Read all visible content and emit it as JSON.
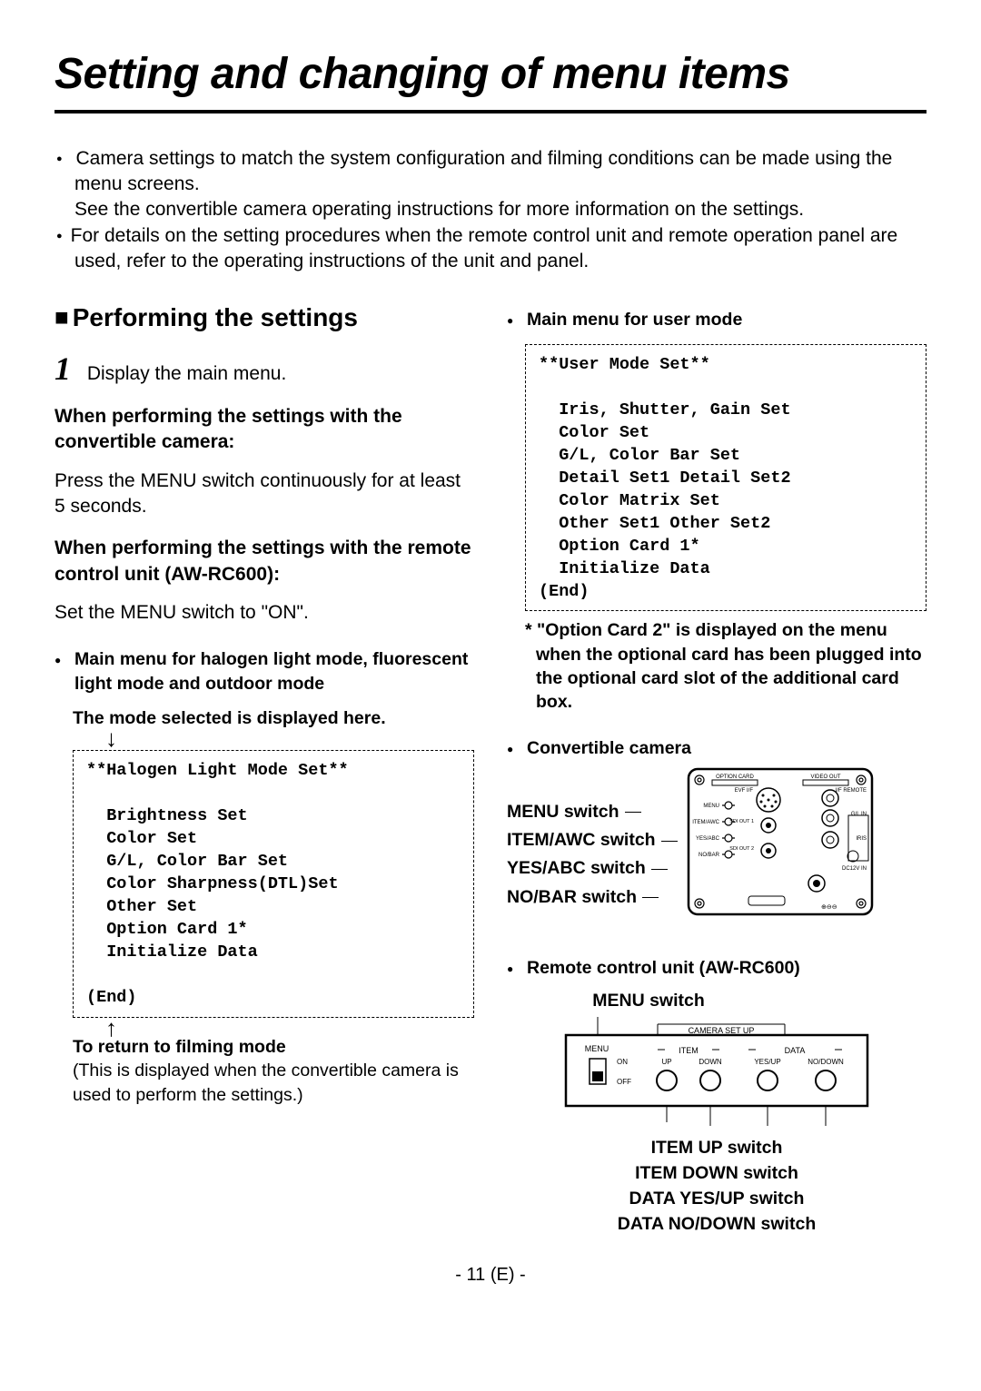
{
  "title": "Setting and changing of menu items",
  "intro": {
    "b1a": "Camera settings to match the system configuration and filming conditions can be made using the menu screens.",
    "b1b": "See the convertible camera operating instructions for more information on the settings.",
    "b2": "For details on the setting procedures when the remote control unit and remote operation panel are used, refer to the operating instructions of the unit and panel."
  },
  "section_heading": "Performing the settings",
  "step1": {
    "label": "Display the main menu.",
    "sub1_title": "When performing the settings with the convertible camera:",
    "sub1_body": "Press the MENU switch continuously for at least 5 seconds.",
    "sub2_title": "When performing the settings with the remote control unit (AW-RC600):",
    "sub2_body": "Set the MENU switch to \"ON\"."
  },
  "halogen": {
    "bullet": "Main menu for halogen light mode, fluorescent light mode and outdoor mode",
    "note_top": "The mode selected is displayed here.",
    "menu_title": "**Halogen Light Mode Set**",
    "lines": [
      "  Brightness Set",
      "  Color Set",
      "  G/L, Color Bar Set",
      "  Color Sharpness(DTL)Set",
      "  Other Set",
      "  Option Card 1*",
      "  Initialize Data"
    ],
    "end": "(End)",
    "return_title": "To return to filming mode",
    "return_body": "(This is displayed when the convertible camera is used to perform the settings.)"
  },
  "user": {
    "bullet": "Main menu for user mode",
    "menu_title": "**User Mode Set**",
    "lines": [
      "  Iris, Shutter, Gain Set",
      "  Color Set",
      "  G/L, Color Bar Set",
      "  Detail Set1 Detail Set2",
      "  Color Matrix Set",
      "  Other Set1 Other Set2",
      "  Option Card 1*",
      "  Initialize Data"
    ],
    "end": "(End)",
    "asterisk": "* \"Option Card 2\" is displayed on the menu when the optional card has been plugged into the optional card slot of the additional card box."
  },
  "camera": {
    "bullet": "Convertible camera",
    "labels": [
      "MENU switch",
      "ITEM/AWC switch",
      "YES/ABC switch",
      "NO/BAR switch"
    ],
    "ports": {
      "option_card": "OPTION CARD",
      "video_out": "VIDEO OUT",
      "evf": "EVF I/F",
      "ifremote": "I/F REMOTE",
      "menu": "MENU",
      "item": "ITEM/AWC",
      "yes": "YES/ABC",
      "no": "NO/BAR",
      "sdi1": "SDI OUT 1",
      "sdi2": "SDI OUT 2",
      "glin": "G/L IN",
      "iris": "IRIS",
      "dc": "DC12V IN"
    }
  },
  "rc": {
    "bullet": "Remote control unit (AW-RC600)",
    "top_label": "MENU switch",
    "diag": {
      "group": "CAMERA SET UP",
      "menu": "MENU",
      "on": "ON",
      "off": "OFF",
      "item": "ITEM",
      "up": "UP",
      "down": "DOWN",
      "data": "DATA",
      "yesup": "YES/UP",
      "nodown": "NO/DOWN"
    },
    "bottom_labels": [
      "ITEM UP switch",
      "ITEM DOWN switch",
      "DATA YES/UP switch",
      "DATA NO/DOWN switch"
    ]
  },
  "pagenum": "- 11 (E) -"
}
